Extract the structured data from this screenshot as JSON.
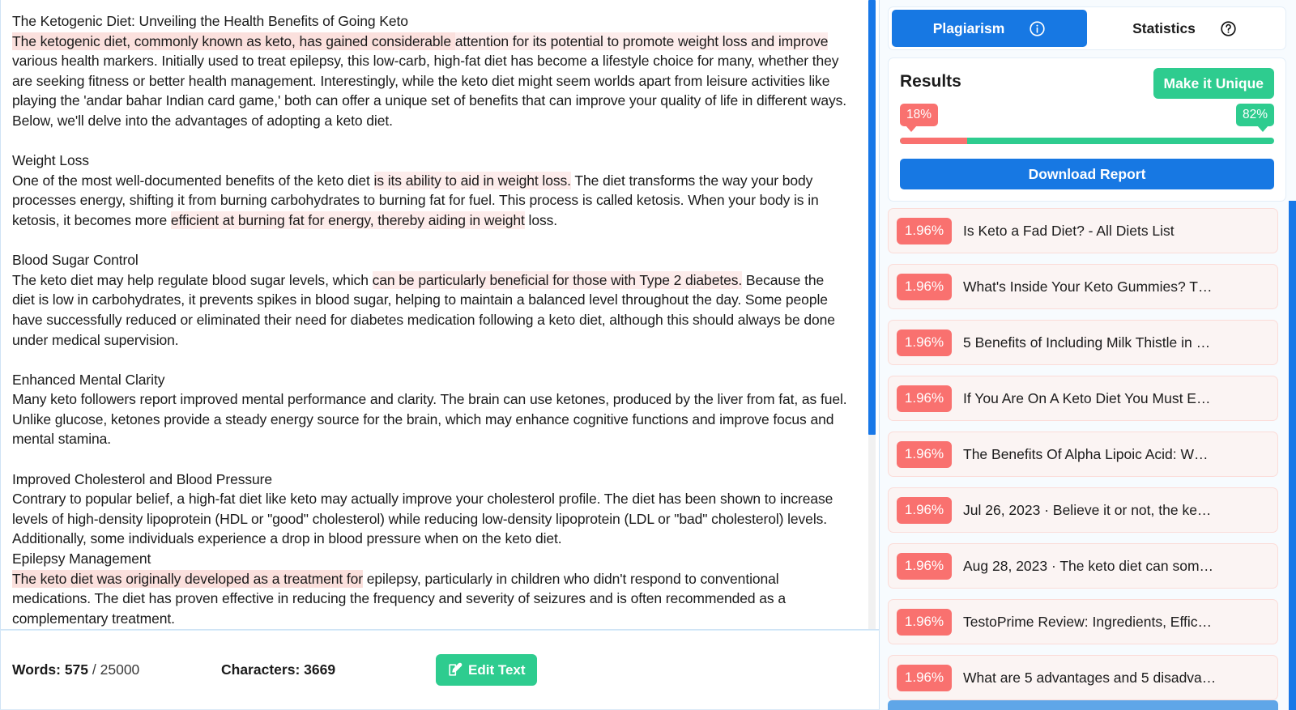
{
  "editor": {
    "paragraphs": [
      {
        "id": "title-line",
        "runs": [
          {
            "t": "The Ketogenic Diet: Unveiling the Health Benefits of Going Keto",
            "hl": "none"
          }
        ]
      },
      {
        "id": "intro-paragraph",
        "runs": [
          {
            "t": "The ketogenic diet, commonly known as keto, has gained considerable ",
            "hl": "strong"
          },
          {
            "t": "attention for its potential to promote weight loss and improve",
            "hl": "light"
          },
          {
            "t": " various health markers. Initially used to treat epilepsy, this low-carb, high-fat diet has become a lifestyle choice for many, whether they are seeking fitness or better health management. Interestingly, while the keto diet might seem worlds apart from leisure activities like playing the 'andar bahar Indian card game,' both can offer a unique set of benefits that can improve your quality of life in different ways. Below, we'll delve into the advantages of adopting a keto diet.",
            "hl": "none"
          }
        ]
      },
      {
        "id": "blank-1",
        "runs": []
      },
      {
        "id": "heading-weight-loss",
        "runs": [
          {
            "t": "Weight Loss",
            "hl": "none"
          }
        ]
      },
      {
        "id": "paragraph-weight-loss",
        "runs": [
          {
            "t": "One of the most well-documented benefits of the keto diet ",
            "hl": "none"
          },
          {
            "t": "is its ability to aid in weight loss.",
            "hl": "light"
          },
          {
            "t": " The diet transforms the way your body processes energy, shifting it from burning carbohydrates to burning fat for fuel. This process is called ketosis. When your body is in ketosis, it becomes more ",
            "hl": "none"
          },
          {
            "t": "efficient at burning fat for energy, thereby aiding in weight",
            "hl": "light"
          },
          {
            "t": " loss.",
            "hl": "none"
          }
        ]
      },
      {
        "id": "blank-2",
        "runs": []
      },
      {
        "id": "heading-blood-sugar",
        "runs": [
          {
            "t": "Blood Sugar Control",
            "hl": "none"
          }
        ]
      },
      {
        "id": "paragraph-blood-sugar",
        "runs": [
          {
            "t": "The keto diet may help regulate blood sugar levels, which ",
            "hl": "none"
          },
          {
            "t": "can be particularly beneficial for those with Type 2 diabetes.",
            "hl": "light"
          },
          {
            "t": " Because the diet is low in carbohydrates, it prevents spikes in blood sugar, helping to maintain a balanced level throughout the day. Some people have successfully reduced or eliminated their need for diabetes medication following a keto diet, although this should always be done under medical supervision.",
            "hl": "none"
          }
        ]
      },
      {
        "id": "blank-3",
        "runs": []
      },
      {
        "id": "heading-mental-clarity",
        "runs": [
          {
            "t": "Enhanced Mental Clarity",
            "hl": "none"
          }
        ]
      },
      {
        "id": "paragraph-mental-clarity",
        "runs": [
          {
            "t": "Many keto followers report improved mental performance and clarity. The brain can use ketones, produced by the liver from fat, as fuel. Unlike glucose, ketones provide a steady energy source for the brain, which may enhance cognitive functions and improve focus and mental stamina.",
            "hl": "none"
          }
        ]
      },
      {
        "id": "blank-4",
        "runs": []
      },
      {
        "id": "heading-cholesterol",
        "runs": [
          {
            "t": "Improved Cholesterol and Blood Pressure",
            "hl": "none"
          }
        ]
      },
      {
        "id": "paragraph-cholesterol",
        "runs": [
          {
            "t": "Contrary to popular belief, a high-fat diet like keto may actually improve your cholesterol profile. The diet has been shown to increase levels of high-density lipoprotein (HDL or \"good\" cholesterol) while reducing low-density lipoprotein (LDL or \"bad\" cholesterol) levels. Additionally, some individuals experience a drop in blood pressure when on the keto diet.",
            "hl": "none"
          }
        ]
      },
      {
        "id": "heading-epilepsy",
        "runs": [
          {
            "t": "Epilepsy Management",
            "hl": "none"
          }
        ]
      },
      {
        "id": "paragraph-epilepsy",
        "runs": [
          {
            "t": "The keto diet was originally developed as a treatment for",
            "hl": "strong"
          },
          {
            "t": " epilepsy, particularly in children who didn't respond to conventional medications. The diet has proven effective in reducing the frequency and severity of seizures and is often recommended as a complementary treatment.",
            "hl": "none"
          }
        ]
      }
    ]
  },
  "status_bar": {
    "words_label": "Words:",
    "words_count": "575",
    "words_limit": "/ 25000",
    "characters_label": "Characters:",
    "characters_count": "3669",
    "edit_text_label": "Edit Text",
    "edit_icon": "pencil-square-icon"
  },
  "panel": {
    "tabs": [
      {
        "label": "Plagiarism",
        "icon": "info-circle-icon",
        "active": true
      },
      {
        "label": "Statistics",
        "icon": "question-circle-icon",
        "active": false
      }
    ],
    "results": {
      "title": "Results",
      "make_unique_label": "Make it Unique",
      "plagiarism_percent": "18%",
      "unique_percent": "82%",
      "plagiarism_value": 18,
      "unique_value": 82,
      "download_label": "Download Report",
      "colors": {
        "plagiarism": "#f9716f",
        "unique": "#2ecc8f",
        "primary": "#1778e3",
        "accent_green": "#2ecc8f"
      }
    },
    "matches": [
      {
        "percent": "1.96%",
        "title": "Is Keto a Fad Diet? - All Diets List"
      },
      {
        "percent": "1.96%",
        "title": "What's Inside Your Keto Gummies? T…"
      },
      {
        "percent": "1.96%",
        "title": "5 Benefits of Including Milk Thistle in …"
      },
      {
        "percent": "1.96%",
        "title": "If You Are On A Keto Diet You Must E…"
      },
      {
        "percent": "1.96%",
        "title": "The Benefits Of Alpha Lipoic Acid: W…"
      },
      {
        "percent": "1.96%",
        "title": "Jul 26, 2023 · Believe it or not, the ke…"
      },
      {
        "percent": "1.96%",
        "title": "Aug 28, 2023 · The keto diet can som…"
      },
      {
        "percent": "1.96%",
        "title": "TestoPrime Review: Ingredients, Effic…"
      },
      {
        "percent": "1.96%",
        "title": "What are 5 advantages and 5 disadva…"
      }
    ]
  }
}
